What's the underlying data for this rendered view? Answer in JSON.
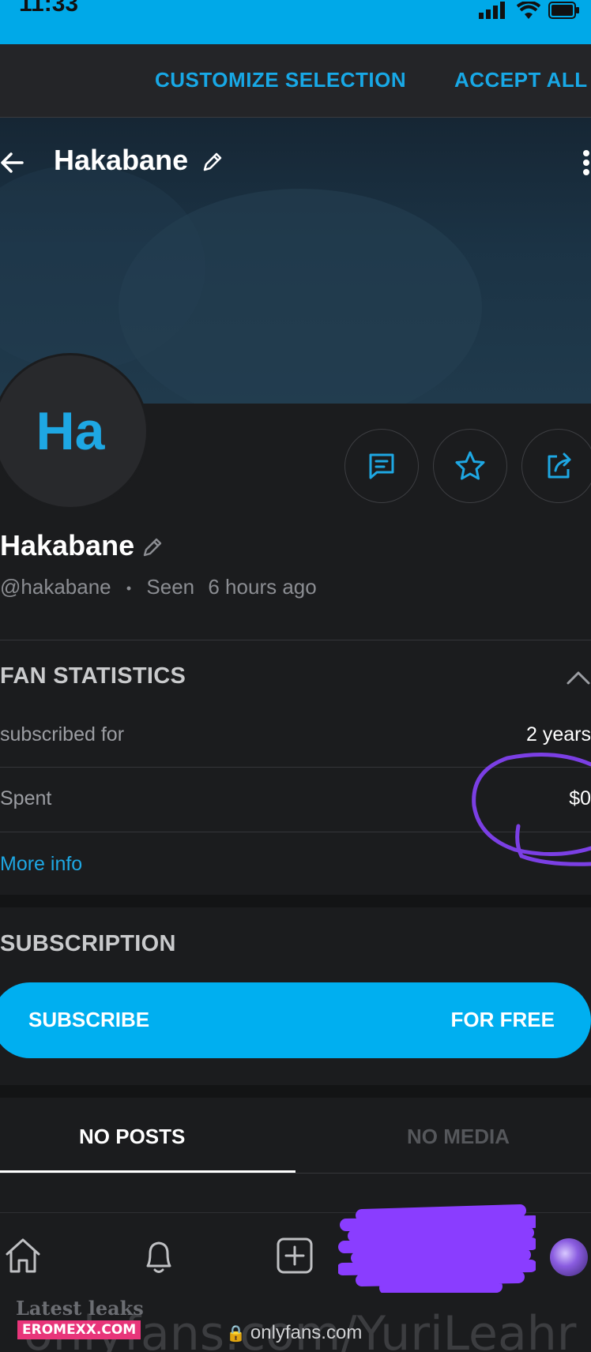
{
  "status_bar": {
    "time": "11:33"
  },
  "cookie_banner": {
    "customize_label": "CUSTOMIZE SELECTION",
    "accept_label": "ACCEPT ALL"
  },
  "header": {
    "title": "Hakabane"
  },
  "profile": {
    "avatar_initials": "Ha",
    "display_name": "Hakabane",
    "handle": "@hakabane",
    "separator": "•",
    "seen_label": "Seen",
    "seen_time": "6 hours ago"
  },
  "fan_statistics": {
    "title": "FAN STATISTICS",
    "rows": [
      {
        "label": "subscribed for",
        "value": "2 years"
      },
      {
        "label": "Spent",
        "value": "$0"
      }
    ],
    "more_info": "More info"
  },
  "subscription": {
    "title": "SUBSCRIPTION",
    "button_left": "SUBSCRIBE",
    "button_right": "FOR FREE"
  },
  "tabs": [
    {
      "label": "NO POSTS",
      "active": true
    },
    {
      "label": "NO MEDIA",
      "active": false
    }
  ],
  "footer": {
    "latest_leaks": "Latest leaks",
    "watermark": "EROMEXX.COM",
    "url_large": "onlyfans.com/YuriLeahr",
    "url_small": "onlyfans.com"
  },
  "colors": {
    "accent": "#00aff0",
    "background": "#1b1c1e",
    "annotation": "#7b3fe4"
  }
}
